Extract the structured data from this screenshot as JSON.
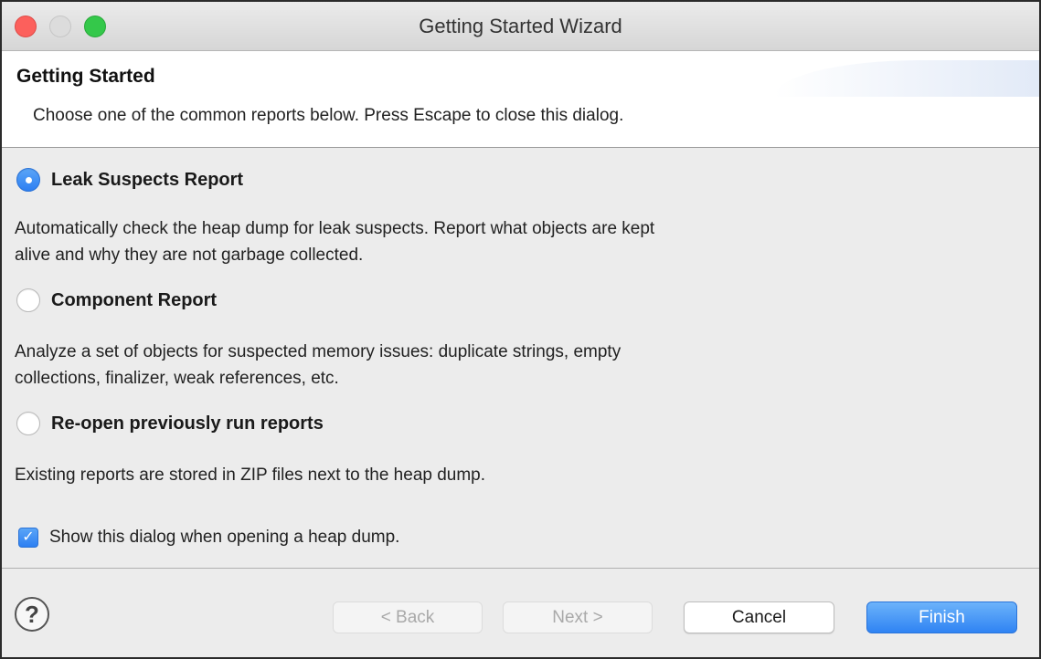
{
  "window": {
    "title": "Getting Started Wizard"
  },
  "header": {
    "title": "Getting Started",
    "description": "Choose one of the common reports below. Press Escape to close this dialog."
  },
  "options": [
    {
      "label": "Leak Suspects Report",
      "selected": true,
      "description": [
        "Automatically check the heap dump for leak suspects. Report what objects are kept",
        "alive and why they are not garbage collected."
      ]
    },
    {
      "label": "Component Report",
      "selected": false,
      "description": [
        "Analyze a set of objects for suspected memory issues: duplicate strings, empty",
        "collections, finalizer, weak references, etc."
      ]
    },
    {
      "label": "Re-open previously run reports",
      "selected": false,
      "description": [
        "Existing reports are stored in ZIP files next to the heap dump."
      ]
    }
  ],
  "show_dialog": {
    "label": "Show this dialog when opening a heap dump.",
    "checked": true
  },
  "footer": {
    "help_icon": "?",
    "back_label": "< Back",
    "next_label": "Next >",
    "cancel_label": "Cancel",
    "finish_label": "Finish"
  },
  "colors": {
    "accent": "#2d7ff2",
    "close": "#fc605c",
    "maximize": "#34c84a"
  }
}
